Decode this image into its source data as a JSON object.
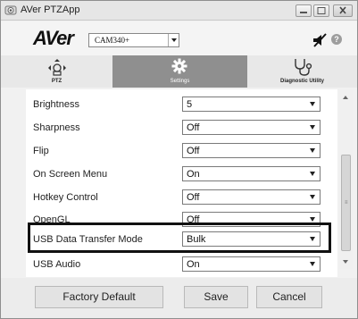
{
  "window": {
    "title": "AVer PTZApp"
  },
  "header": {
    "logo_text": "AVer",
    "model": "CAM340+"
  },
  "nav": {
    "ptz_label": "PTZ",
    "settings_label": "Settings",
    "diagnostic_label": "Diagnostic Utility",
    "active": "Settings"
  },
  "settings": {
    "rows": [
      {
        "label": "Brightness",
        "value": "5"
      },
      {
        "label": "Sharpness",
        "value": "Off"
      },
      {
        "label": "Flip",
        "value": "Off"
      },
      {
        "label": "On Screen Menu",
        "value": "On"
      },
      {
        "label": "Hotkey Control",
        "value": "Off"
      },
      {
        "label": "OpenGL",
        "value": "Off"
      },
      {
        "label": "USB Data Transfer Mode",
        "value": "Bulk"
      },
      {
        "label": "USB Audio",
        "value": "On"
      }
    ]
  },
  "footer": {
    "factory_default_label": "Factory Default",
    "save_label": "Save",
    "cancel_label": "Cancel"
  },
  "colors": {
    "nav_bar": "#8f8f8f",
    "highlight_border": "#111111"
  }
}
